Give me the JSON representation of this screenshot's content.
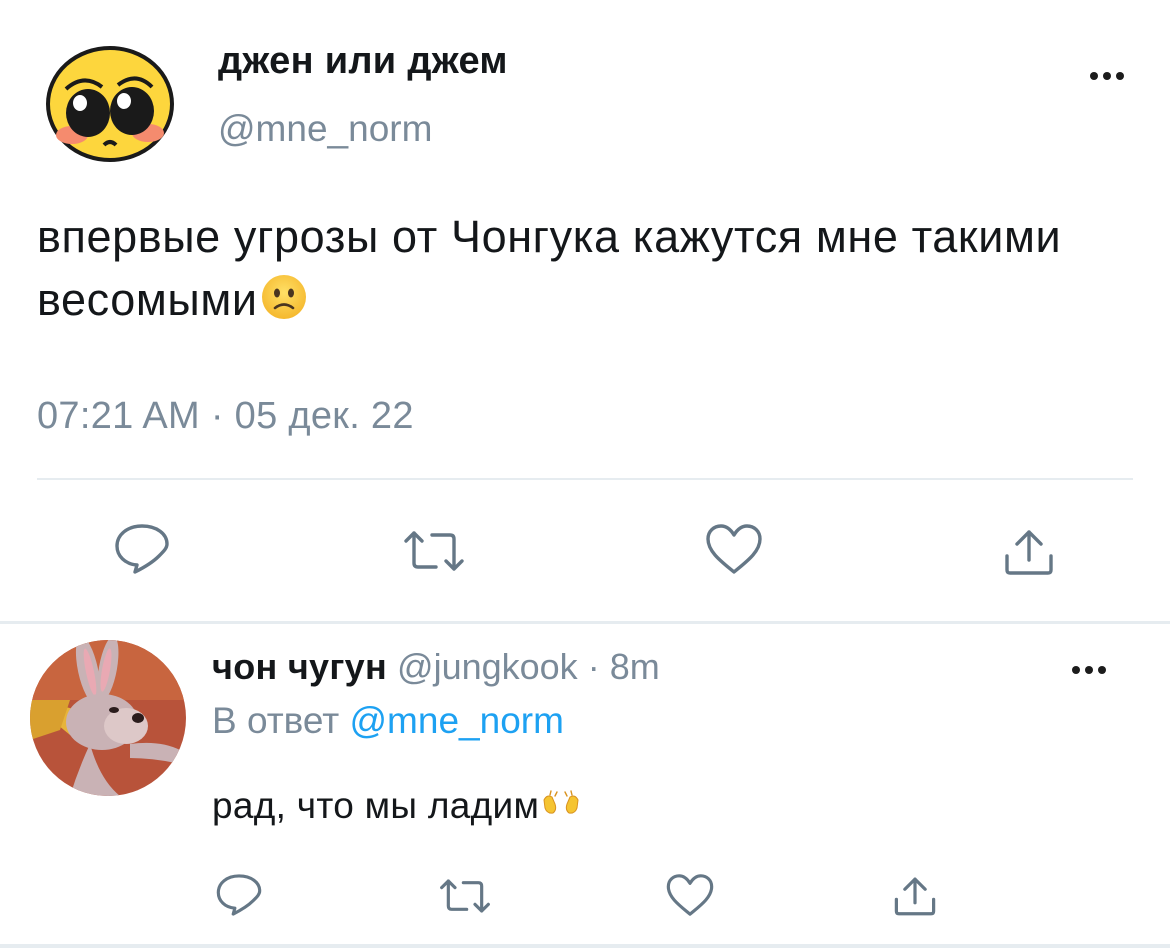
{
  "tweet": {
    "display_name": "джен или джем",
    "handle": "@mne_norm",
    "text": "впервые угрозы от Чонгука кажутся мне такими весомыми",
    "text_emoji": "slightly-frowning-face",
    "time": "07:21 AM",
    "date_sep": " · ",
    "date": "05 дек. 22",
    "actions": [
      "reply-icon",
      "retweet-icon",
      "like-icon",
      "share-icon"
    ]
  },
  "reply": {
    "display_name": "чон чугун",
    "handle": "@jungkook",
    "time_sep": " · ",
    "time": "8m",
    "reply_prefix": "В ответ",
    "reply_mention": "@mne_norm",
    "text": "рад, что мы ладим",
    "text_emoji": "open-hands",
    "actions": [
      "reply-icon",
      "retweet-icon",
      "like-icon",
      "share-icon"
    ]
  },
  "colors": {
    "text": "#14171a",
    "secondary": "#7a8a99",
    "link": "#1da1f2",
    "divider": "#e6ecf0",
    "icon": "#657786"
  }
}
